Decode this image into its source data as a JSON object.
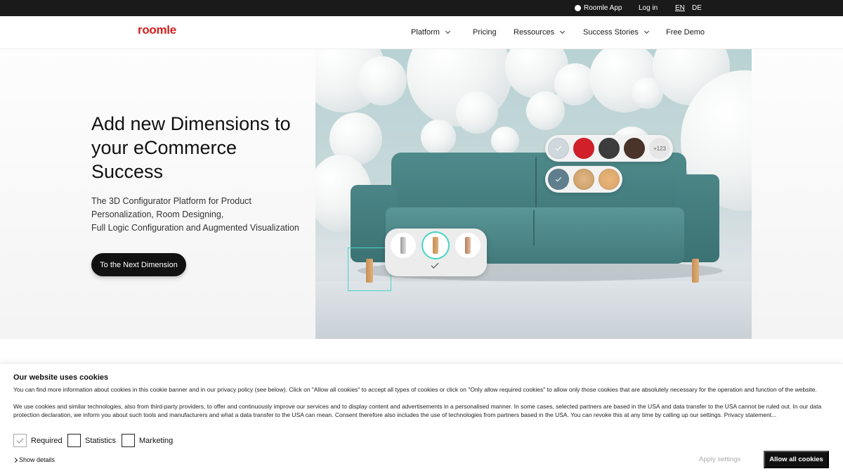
{
  "topbar": {
    "app_label": "Roomle App",
    "login_label": "Log in",
    "lang_en": "EN",
    "lang_de": "DE"
  },
  "nav": {
    "logo": "roomle",
    "items": [
      {
        "label": "Platform",
        "has_dropdown": true
      },
      {
        "label": "Pricing",
        "has_dropdown": false
      },
      {
        "label": "Ressources",
        "has_dropdown": true
      },
      {
        "label": "Success Stories",
        "has_dropdown": true
      },
      {
        "label": "Free Demo",
        "has_dropdown": false
      }
    ]
  },
  "hero": {
    "title": "Add new Dimensions to your eCommerce Success",
    "subtitle_lines": [
      "The 3D Configurator Platform for Product",
      "Personalization, Room Designing,",
      "Full Logic Configuration and Augmented Visualization"
    ],
    "cta_label": "To the Next Dimension",
    "fabric_swatches": [
      "#cfd8dc",
      "#d2202a",
      "#3c3c3c",
      "#4a3328"
    ],
    "fabric_more": "+123",
    "wood_swatches": [
      "#5f7f8e",
      "#c99a62",
      "#d8a468"
    ],
    "sofa_color": "#4a8384"
  },
  "cookie": {
    "title": "Our website uses cookies",
    "para1": "You can find more information about cookies in this cookie banner and in our privacy policy (see below). Click on \"Allow all cookies\" to accept all types of cookies or click on \"Only allow required cookies\" to allow only those cookies that are absolutely necessary for the operation and function of the website.",
    "para2": "We use cookies and similar technologies, also from third-party providers, to offer and continuously improve our services and to display content and advertisements in a personalised manner. In some cases, selected partners are based in the USA and data transfer to the USA cannot be ruled out. In our data protection declaration, we inform you about such tools and manufacturers and what a data transfer to the USA can mean. Consent therefore also includes the use of technologies from partners based in the USA. You can revoke this at any time by calling up our settings. Privacy statement...",
    "options": [
      {
        "label": "Required",
        "checked": true,
        "disabled": true
      },
      {
        "label": "Statistics",
        "checked": false,
        "disabled": false
      },
      {
        "label": "Marketing",
        "checked": false,
        "disabled": false
      }
    ],
    "show_details": "Show details",
    "apply_label": "Apply settings",
    "allow_label": "Allow all cookies"
  }
}
